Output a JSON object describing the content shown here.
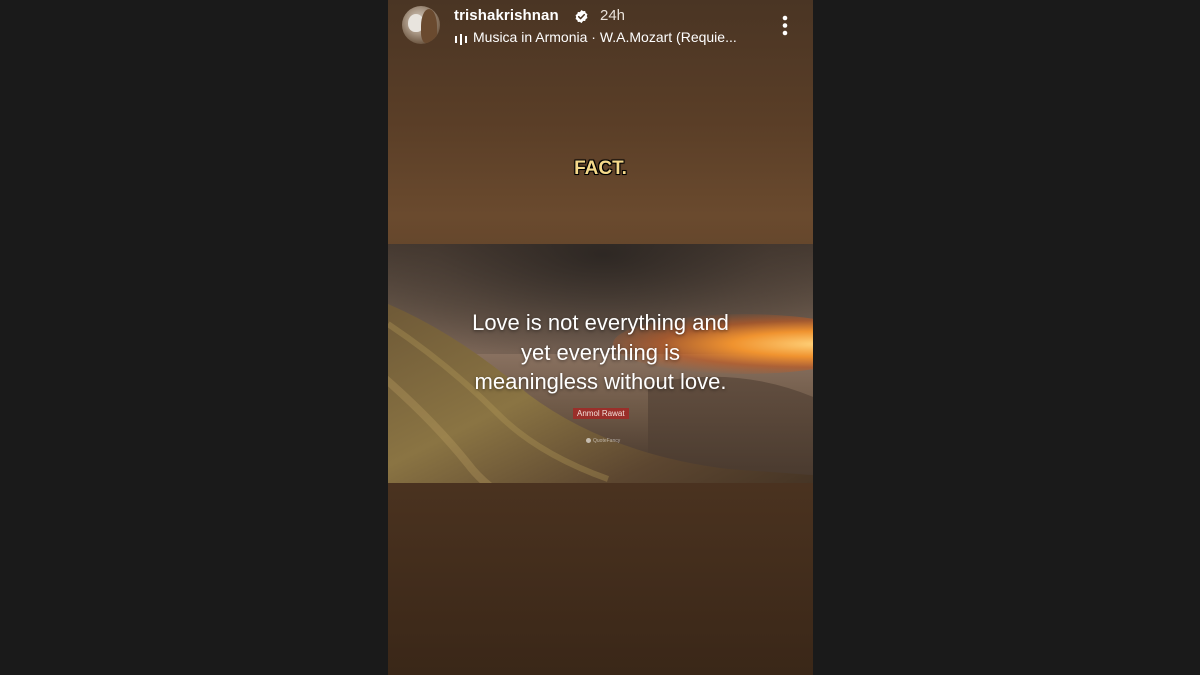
{
  "story": {
    "username": "trishakrishnan",
    "verified_icon": "verified-badge-icon",
    "time": "24h",
    "music_icon": "audio-bars-icon",
    "music": "Musica in Armonia · W.A.Mozart (Requie...",
    "more_icon": "more-vertical-icon",
    "caption": "FACT."
  },
  "quote": {
    "lines": [
      "Love is not everything and",
      "yet everything is",
      "meaningless without love."
    ],
    "author": "Anmol Rawat",
    "watermark": "QuoteFancy"
  },
  "colors": {
    "caption": "#f5d98a",
    "author_badge": "#9a2f2a",
    "page_background": "#1a1a1a"
  }
}
